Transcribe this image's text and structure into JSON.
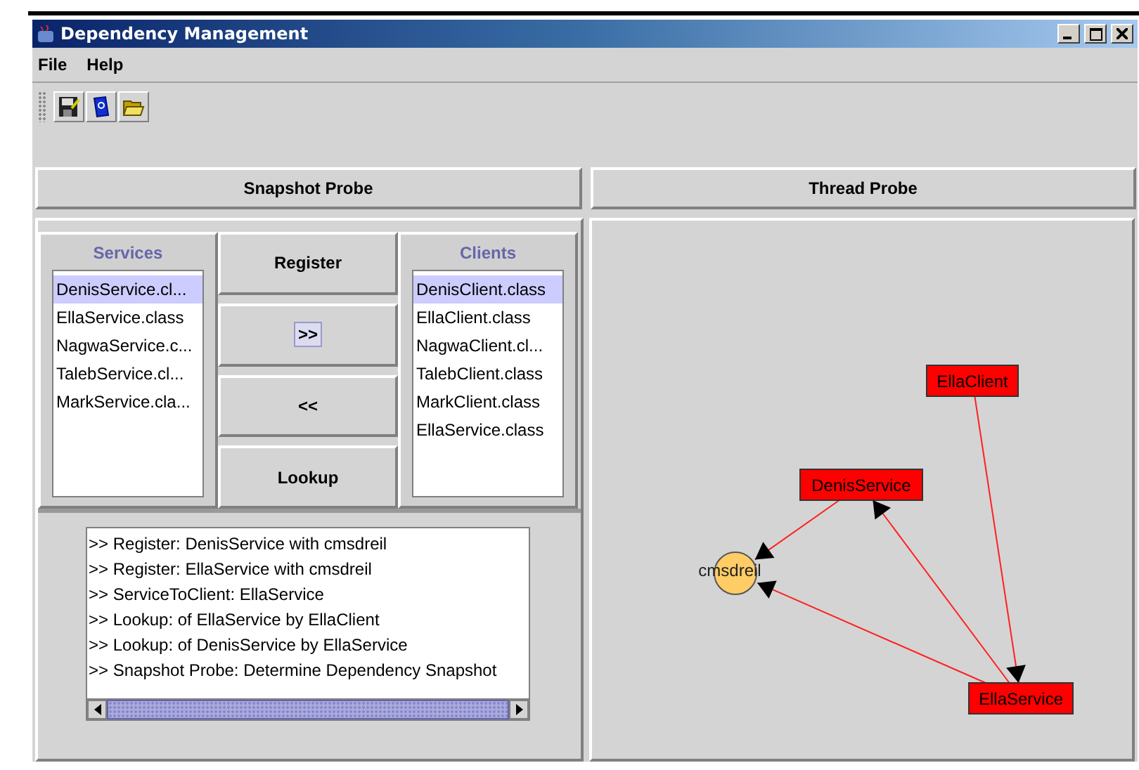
{
  "window": {
    "title": "Dependency Management"
  },
  "menu": [
    "File",
    "Help"
  ],
  "probes": [
    {
      "label": "Snapshot Probe"
    },
    {
      "label": "Thread Probe"
    }
  ],
  "services": {
    "title": "Services",
    "items": [
      {
        "label": "DenisService.cl...",
        "selected": true
      },
      {
        "label": "EllaService.class",
        "selected": false
      },
      {
        "label": "NagwaService.c...",
        "selected": false
      },
      {
        "label": "TalebService.cl...",
        "selected": false
      },
      {
        "label": "MarkService.cla...",
        "selected": false
      }
    ]
  },
  "actions": [
    {
      "label": "Register",
      "focused": false
    },
    {
      "label": ">>",
      "focused": true
    },
    {
      "label": "<<",
      "focused": false
    },
    {
      "label": "Lookup",
      "focused": false
    }
  ],
  "clients": {
    "title": "Clients",
    "items": [
      {
        "label": "DenisClient.class",
        "selected": true
      },
      {
        "label": "EllaClient.class",
        "selected": false
      },
      {
        "label": "NagwaClient.cl...",
        "selected": false
      },
      {
        "label": "TalebClient.class",
        "selected": false
      },
      {
        "label": "MarkClient.class",
        "selected": false
      },
      {
        "label": "EllaService.class",
        "selected": false
      }
    ]
  },
  "log": [
    ">> Register: DenisService with cmsdreil",
    ">> Register: EllaService with cmsdreil",
    ">> ServiceToClient: EllaService",
    ">> Lookup: of EllaService by EllaClient",
    ">> Lookup: of DenisService by EllaService",
    ">> Snapshot Probe: Determine Dependency Snapshot"
  ],
  "graph": {
    "nodes": [
      {
        "label": "EllaClient",
        "kind": "class",
        "color": "#ff0000"
      },
      {
        "label": "DenisService",
        "kind": "class",
        "color": "#ff0000"
      },
      {
        "label": "cmsdreil",
        "kind": "host",
        "color": "#ffcc66"
      },
      {
        "label": "EllaService",
        "kind": "class",
        "color": "#ff0000"
      }
    ]
  }
}
